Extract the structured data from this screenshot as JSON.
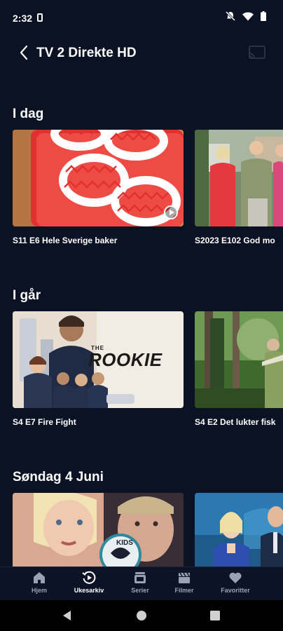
{
  "status_bar": {
    "time": "2:32"
  },
  "header": {
    "title": "TV 2 Direkte HD"
  },
  "sections": [
    {
      "title": "I dag",
      "items": [
        "S11 E6 Hele Sverige baker",
        "S2023 E102 God mo"
      ]
    },
    {
      "title": "I går",
      "items": [
        "S4 E7 Fire Fight",
        "S4 E2 Det lukter fisk"
      ]
    },
    {
      "title": "Søndag 4 Juni",
      "items": [
        "",
        ""
      ]
    }
  ],
  "bottom_nav": [
    {
      "label": "Hjem",
      "icon": "home-icon"
    },
    {
      "label": "Ukesarkiv",
      "icon": "replay-icon",
      "active": true
    },
    {
      "label": "Serier",
      "icon": "series-icon"
    },
    {
      "label": "Filmer",
      "icon": "clapper-icon"
    },
    {
      "label": "Favoritter",
      "icon": "heart-icon"
    }
  ],
  "thumbnail_texts": {
    "rookie_logo": "THE ROOKIE",
    "kids_badge": "KIDS"
  },
  "colors": {
    "background": "#0b1224",
    "accent_red": "#e0312f"
  }
}
